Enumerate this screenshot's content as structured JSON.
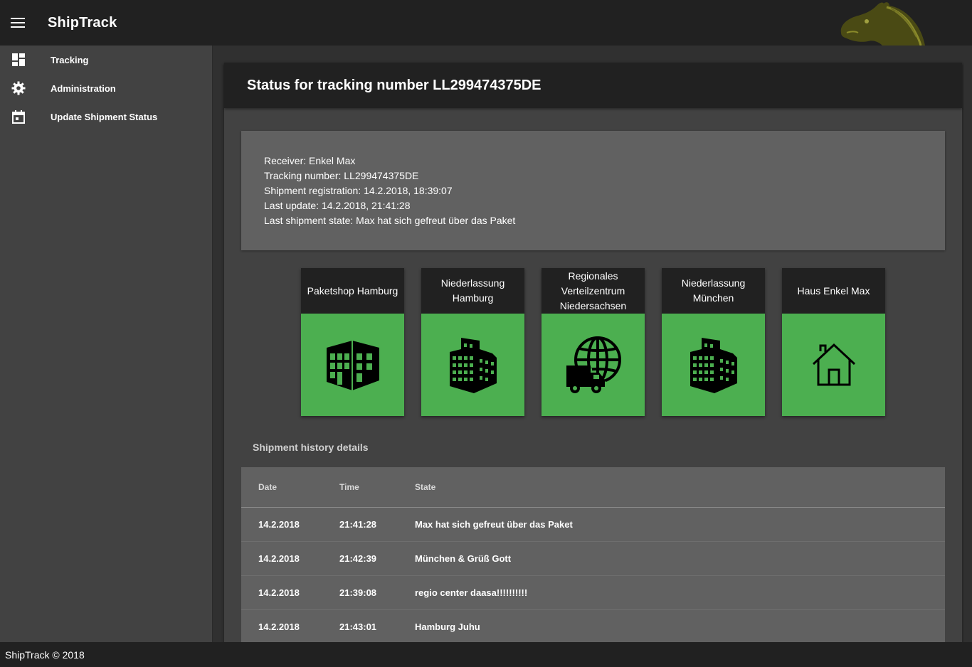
{
  "app": {
    "title": "ShipTrack",
    "footer": "ShipTrack © 2018"
  },
  "icons": {
    "menu": "menu-icon",
    "logo": "horse-head-logo"
  },
  "sidebar": {
    "items": [
      {
        "label": "Tracking",
        "icon": "dashboard-icon"
      },
      {
        "label": "Administration",
        "icon": "gear-icon"
      },
      {
        "label": "Update Shipment Status",
        "icon": "calendar-icon"
      }
    ]
  },
  "status": {
    "title": "Status for tracking number LL299474375DE",
    "info": [
      "Receiver: Enkel Max",
      "Tracking number: LL299474375DE",
      "Shipment registration: 14.2.2018, 18:39:07",
      "Last update: 14.2.2018, 21:41:28",
      "Last shipment state: Max hat sich gefreut über das Paket"
    ]
  },
  "steps": [
    {
      "label": "Paketshop Hamburg",
      "icon": "shop-building-icon"
    },
    {
      "label": "Niederlassung Hamburg",
      "icon": "office-building-icon"
    },
    {
      "label": "Regionales Verteilzentrum Niedersachsen",
      "icon": "globe-truck-icon"
    },
    {
      "label": "Niederlassung München",
      "icon": "office-building-icon"
    },
    {
      "label": "Haus Enkel Max",
      "icon": "house-icon"
    }
  ],
  "colors": {
    "step_done": "#4caf50",
    "header": "#212121",
    "panel": "#616161"
  },
  "history": {
    "title": "Shipment history details",
    "columns": [
      "Date",
      "Time",
      "State"
    ],
    "rows": [
      [
        "14.2.2018",
        "21:41:28",
        "Max hat sich gefreut über das Paket"
      ],
      [
        "14.2.2018",
        "21:42:39",
        "München & Grüß Gott"
      ],
      [
        "14.2.2018",
        "21:39:08",
        "regio center daasa!!!!!!!!!!"
      ],
      [
        "14.2.2018",
        "21:43:01",
        "Hamburg Juhu"
      ]
    ]
  }
}
